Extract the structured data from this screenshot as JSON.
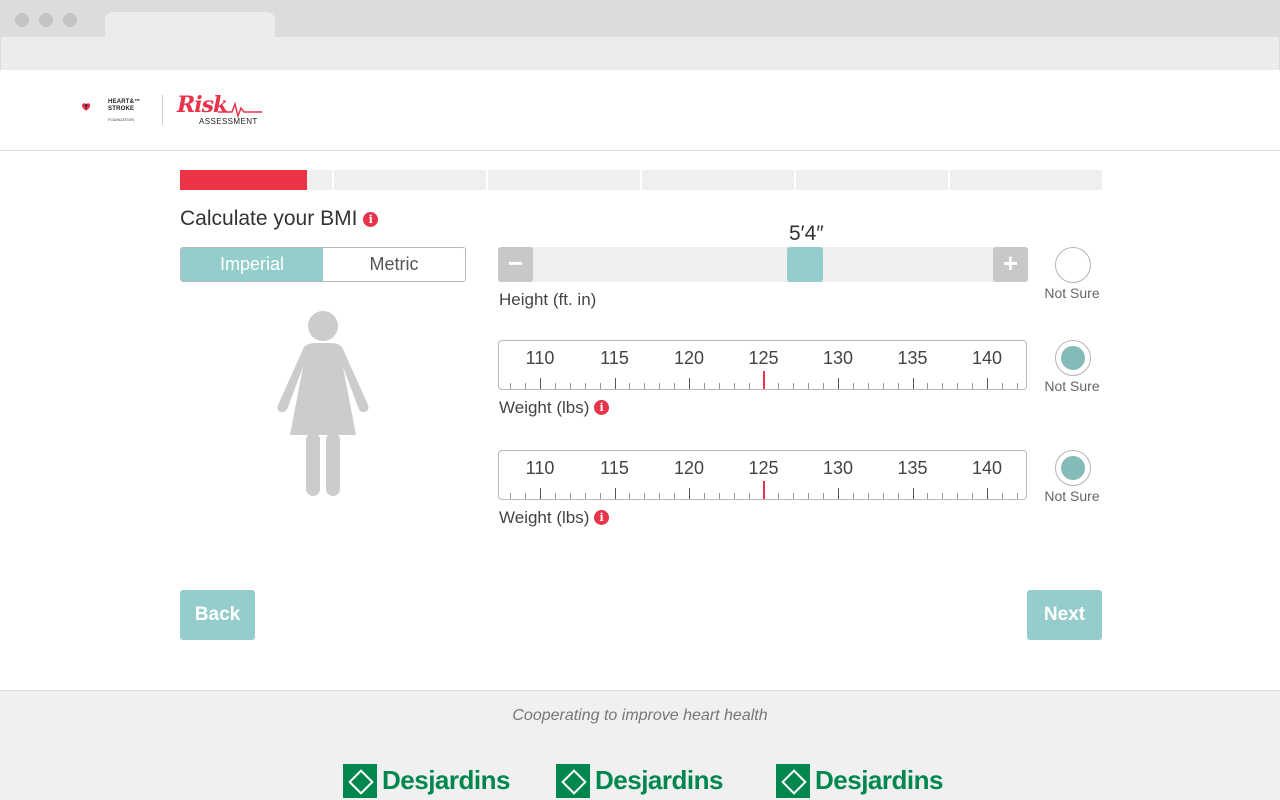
{
  "brand": {
    "hsf_name": "HEART & STROKE",
    "hsf_line1": "HEART&™",
    "hsf_line2": "STROKE",
    "hsf_sub": "FOUNDATION",
    "risk": "Risk",
    "assessment": "ASSESSMENT",
    "accent": "#e8334a",
    "teal": "#94cdcc"
  },
  "progress": {
    "step": 1,
    "total": 6,
    "fraction_of_first": 0.82
  },
  "bmi": {
    "title": "Calculate your BMI",
    "units": {
      "imperial": "Imperial",
      "metric": "Metric",
      "selected": "Imperial"
    },
    "height": {
      "value": "5′4″",
      "label": "Height (ft. in)",
      "minus": "−",
      "plus": "+",
      "slider_fraction": 0.53,
      "not_sure": "Not Sure",
      "not_sure_checked": false
    },
    "weights": [
      {
        "label": "Weight (lbs)",
        "ticks": [
          "110",
          "115",
          "120",
          "125",
          "130",
          "135",
          "140"
        ],
        "value": 125,
        "not_sure": "Not Sure",
        "not_sure_checked": true
      },
      {
        "label": "Weight (lbs)",
        "ticks": [
          "110",
          "115",
          "120",
          "125",
          "130",
          "135",
          "140"
        ],
        "value": 125,
        "not_sure": "Not Sure",
        "not_sure_checked": true
      }
    ]
  },
  "nav": {
    "back": "Back",
    "next": "Next"
  },
  "footer": {
    "tagline": "Cooperating to improve heart health",
    "sponsors": [
      "Desjardins",
      "Desjardins",
      "Desjardins"
    ],
    "sponsor_color": "#00874e"
  }
}
